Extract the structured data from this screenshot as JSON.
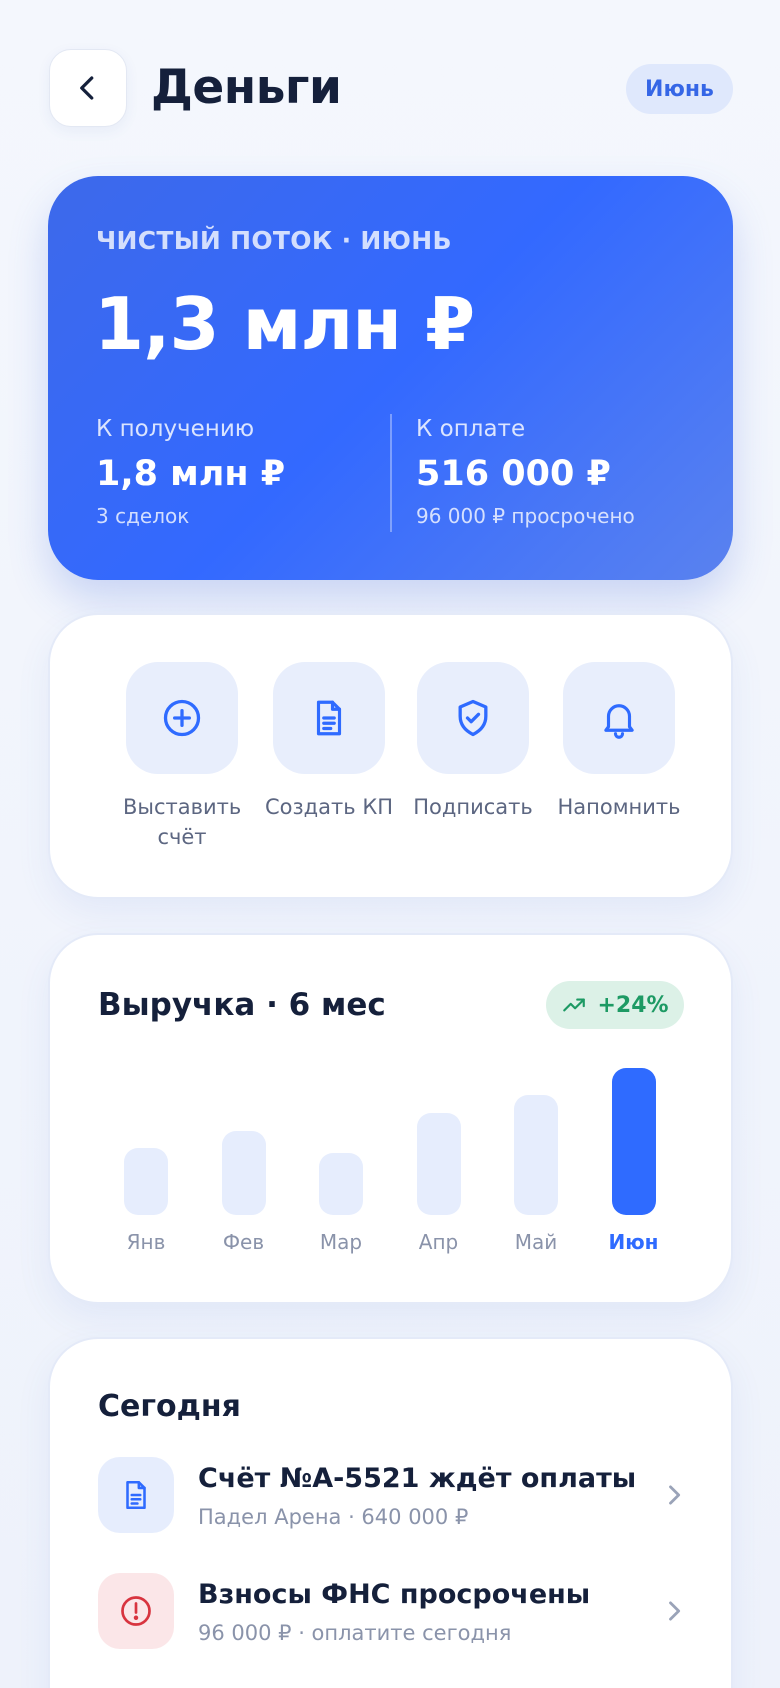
{
  "header": {
    "title": "Деньги",
    "month": "Июнь"
  },
  "hero": {
    "label": "ЧИСТЫЙ ПОТОК · ИЮНЬ",
    "amount": "1,3 млн ₽",
    "receivable": {
      "label": "К получению",
      "value": "1,8 млн ₽",
      "sub": "3 сделок"
    },
    "payable": {
      "label": "К оплате",
      "value": "516 000 ₽",
      "sub": "96 000 ₽ просрочено"
    }
  },
  "actions": [
    {
      "label": "Выставить счёт",
      "icon": "plus-circle-icon"
    },
    {
      "label": "Создать КП",
      "icon": "document-icon"
    },
    {
      "label": "Подписать",
      "icon": "shield-check-icon"
    },
    {
      "label": "Напомнить",
      "icon": "bell-icon"
    }
  ],
  "revenue": {
    "title": "Выручка · 6 мес",
    "growth": "+24%"
  },
  "chart_data": {
    "type": "bar",
    "categories": [
      "Янв",
      "Фев",
      "Мар",
      "Апр",
      "Май",
      "Июн"
    ],
    "values": [
      37,
      46,
      34,
      56,
      66,
      81
    ],
    "highlight": "Июн",
    "ylim": [
      0,
      100
    ],
    "colors": {
      "default": "#e6edfd",
      "highlight": "#2f6bff"
    }
  },
  "today": {
    "title": "Сегодня",
    "items": [
      {
        "title": "Счёт №А-5521 ждёт оплаты",
        "sub": "Падел Арена · 640 000 ₽",
        "icon": "document-icon",
        "tone": "blue"
      },
      {
        "title": "Взносы ФНС просрочены",
        "sub": "96 000 ₽ · оплатите сегодня",
        "icon": "alert-icon",
        "tone": "red"
      }
    ]
  },
  "colors": {
    "accent": "#2f6bff",
    "positive": "#1d9a64",
    "danger": "#d8343f"
  }
}
